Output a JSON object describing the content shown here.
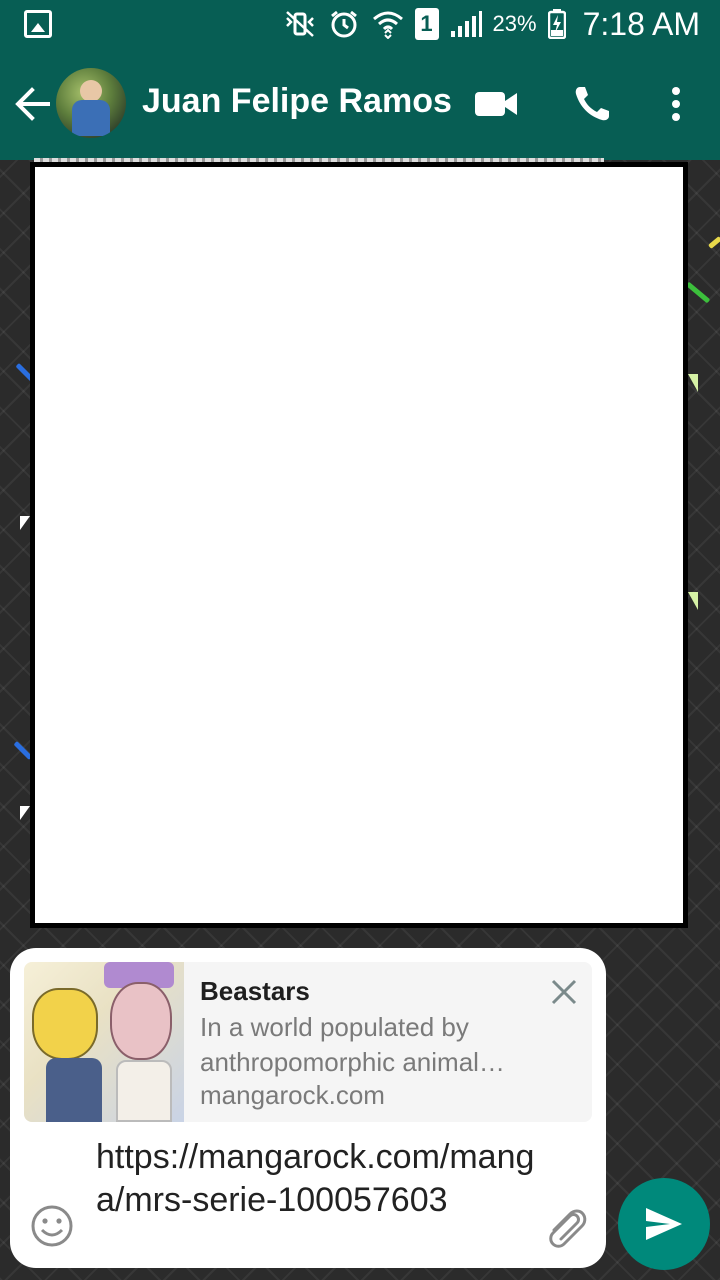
{
  "status_bar": {
    "battery": "23%",
    "time": "7:18 AM",
    "sim_slot": "1",
    "icons": [
      "gallery-icon",
      "vibrate-icon",
      "alarm-icon",
      "wifi-icon",
      "sim-icon",
      "signal-icon",
      "battery-icon"
    ]
  },
  "header": {
    "contact_name": "Juan Felipe Ramos",
    "icons": [
      "back-arrow-icon",
      "avatar",
      "video-call-icon",
      "phone-icon",
      "more-options-icon"
    ]
  },
  "link_preview": {
    "title": "Beastars",
    "description": "In a world populated by anthropomorphic animal…",
    "domain": "mangarock.com"
  },
  "composer": {
    "message": "https://mangarock.com/manga/mrs-serie-100057603"
  },
  "colors": {
    "header": "#075e54",
    "send_button": "#00897b"
  }
}
